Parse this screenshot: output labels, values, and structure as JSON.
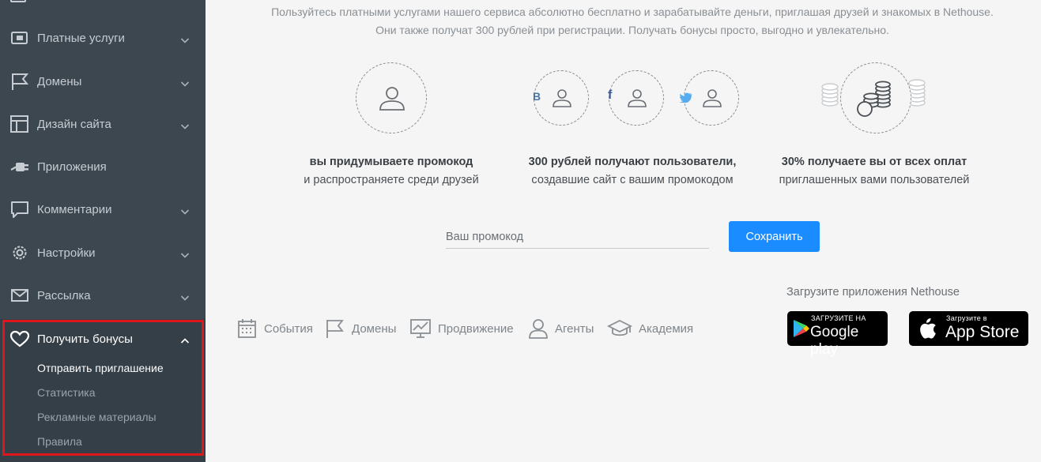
{
  "sidebar": {
    "items": [
      {
        "label": "Платные услуги",
        "icon": "wallet-icon"
      },
      {
        "label": "Домены",
        "icon": "flag-icon"
      },
      {
        "label": "Дизайн сайта",
        "icon": "layout-icon"
      },
      {
        "label": "Приложения",
        "icon": "plug-icon"
      },
      {
        "label": "Комментарии",
        "icon": "comment-icon"
      },
      {
        "label": "Настройки",
        "icon": "gear-icon"
      },
      {
        "label": "Рассылка",
        "icon": "mail-icon"
      }
    ],
    "bonus": {
      "label": "Получить бонусы",
      "icon": "heart-icon",
      "subitems": [
        "Отправить приглашение",
        "Статистика",
        "Рекламные материалы",
        "Правила"
      ],
      "active_index": 0
    }
  },
  "intro": {
    "line1": "Пользуйтесь платными услугами нашего сервиса абсолютно бесплатно и зарабатывайте деньги, приглашая друзей и знакомых в Nethouse.",
    "line2": "Они также получат 300 рублей при регистрации. Получать бонусы просто, выгодно и увлекательно."
  },
  "steps": [
    {
      "title": "вы придумываете промокод",
      "sub": "и распространяете среди друзей"
    },
    {
      "title": "300 рублей получают пользователи,",
      "sub": "создавшие сайт с вашим промокодом"
    },
    {
      "title": "30% получаете вы от всех оплат",
      "sub": "приглашенных вами пользователей"
    }
  ],
  "social_badges": [
    "В",
    "f"
  ],
  "promo": {
    "placeholder": "Ваш промокод",
    "save_label": "Сохранить"
  },
  "footer": {
    "links": [
      {
        "label": "События",
        "icon": "calendar-icon"
      },
      {
        "label": "Домены",
        "icon": "flag-icon"
      },
      {
        "label": "Продвижение",
        "icon": "chart-icon"
      },
      {
        "label": "Агенты",
        "icon": "user-icon"
      },
      {
        "label": "Академия",
        "icon": "graduation-cap-icon"
      }
    ],
    "download_text": "Загрузите приложения Nethouse",
    "google_small": "ЗАГРУЗИТЕ НА",
    "google_big": "Google play",
    "apple_small": "Загрузите в",
    "apple_big": "App Store"
  },
  "colors": {
    "sidebar_bg": "#3c4750",
    "accent": "#1a8cff",
    "highlight_frame": "#e0161d"
  }
}
